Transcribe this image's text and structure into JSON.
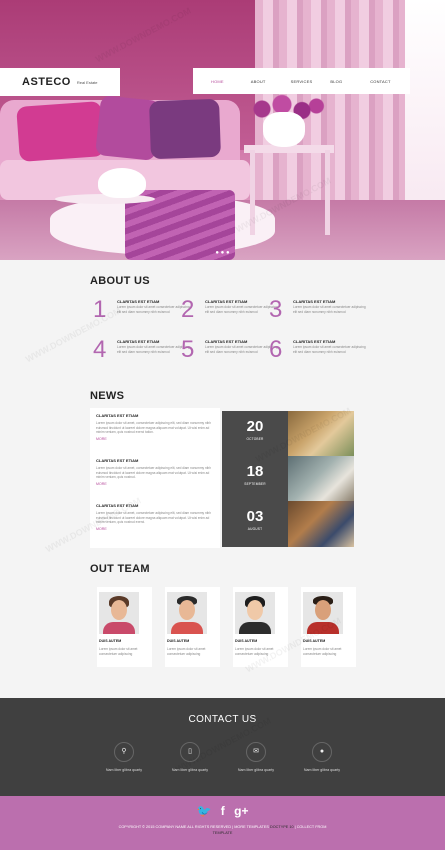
{
  "header": {
    "logo": "ASTECO",
    "logo_sub": "Real Estate",
    "nav": [
      "HOME",
      "ABOUT",
      "SERVICES",
      "BLOG",
      "CONTACT"
    ]
  },
  "hero": {
    "slider_dots": "● ● ●"
  },
  "about": {
    "title": "ABOUT US",
    "items": [
      {
        "num": "1",
        "head": "CLARITAS EST ETIAM",
        "text": "Lorem ipsum dolor sit amet consectetuer adipiscing elit sed diam nonummy nibh euismod"
      },
      {
        "num": "2",
        "head": "CLARITAS EST ETIAM",
        "text": "Lorem ipsum dolor sit amet consectetuer adipiscing elit sed diam nonummy nibh euismod"
      },
      {
        "num": "3",
        "head": "CLARITAS EST ETIAM",
        "text": "Lorem ipsum dolor sit amet consectetuer adipiscing elit sed diam nonummy nibh euismod"
      },
      {
        "num": "4",
        "head": "CLARITAS EST ETIAM",
        "text": "Lorem ipsum dolor sit amet consectetuer adipiscing elit sed diam nonummy nibh euismod"
      },
      {
        "num": "5",
        "head": "CLARITAS EST ETIAM",
        "text": "Lorem ipsum dolor sit amet consectetuer adipiscing elit sed diam nonummy nibh euismod"
      },
      {
        "num": "6",
        "head": "CLARITAS EST ETIAM",
        "text": "Lorem ipsum dolor sit amet consectetuer adipiscing elit sed diam nonummy nibh euismod"
      }
    ]
  },
  "news": {
    "title": "NEWS",
    "items": [
      {
        "head": "CLARITAS EST ETIAM",
        "text": "Lorem ipsum dolor sit amet, consectetuer adipiscing elit, sed diam nonummy nibh euismod tincidunt ut laoreet dolore magna aliquam erat volutpat. Ut wisi enim ad minim veniam, quis nostrud exerci tation.",
        "more": "MORE"
      },
      {
        "head": "CLARITAS EST ETIAM",
        "text": "Lorem ipsum dolor sit amet, consectetuer adipiscing elit, sed diam nonummy nibh euismod tincidunt ut laoreet dolore magna aliquam erat volutpat. Ut wisi enim ad minim veniam, quis nostrud.",
        "more": "MORE"
      },
      {
        "head": "CLARITAS EST ETIAM",
        "text": "Lorem ipsum dolor sit amet, consectetuer adipiscing elit, sed diam nonummy nibh euismod tincidunt ut laoreet dolore magna aliquam erat volutpat. Ut wisi enim ad minim veniam, quis nostrud exerci.",
        "more": "MORE"
      }
    ],
    "dates": [
      {
        "day": "20",
        "month": "OCTOBER"
      },
      {
        "day": "18",
        "month": "SEPTEMBER"
      },
      {
        "day": "03",
        "month": "AUGUST"
      }
    ]
  },
  "team": {
    "title": "OUT TEAM",
    "members": [
      {
        "name": "DUIS AUTEM",
        "text": "Lorem ipsum dolor sit amet consectetuer adipiscing"
      },
      {
        "name": "DUIS AUTEM",
        "text": "Lorem ipsum dolor sit amet consectetuer adipiscing"
      },
      {
        "name": "DUIS AUTEM",
        "text": "Lorem ipsum dolor sit amet consectetuer adipiscing"
      },
      {
        "name": "DUIS AUTEM",
        "text": "Lorem ipsum dolor sit amet consectetuer adipiscing"
      }
    ]
  },
  "contact": {
    "title": "CONTACT US",
    "items": [
      {
        "icon": "map-pin-icon",
        "glyph": "⚲",
        "text": "Nam liber glibra quarty"
      },
      {
        "icon": "phone-icon",
        "glyph": "▯",
        "text": "Nam liber glibra quarty"
      },
      {
        "icon": "envelope-icon",
        "glyph": "✉",
        "text": "Nam liber glibra quarty"
      },
      {
        "icon": "info-icon",
        "glyph": "●",
        "text": "Nam liber glibra quarty"
      }
    ]
  },
  "footer": {
    "social": [
      "🐦",
      "f",
      "g+"
    ],
    "copyright_line1": "COPYRIGHT © 2015 COMPANY NAME ALL RIGHTS RESERVED | MORE TEMPLATES ",
    "copyright_link": "DOCTYPE 10",
    "copyright_line1_end": " | COLLECT FROM",
    "copyright_line2": "TEMPLATE"
  },
  "watermark": "WWW.DOWNDEMO.COM",
  "colors": {
    "accent": "#b266b0",
    "footer_bg": "#bb6fae",
    "contact_bg": "#404040"
  }
}
